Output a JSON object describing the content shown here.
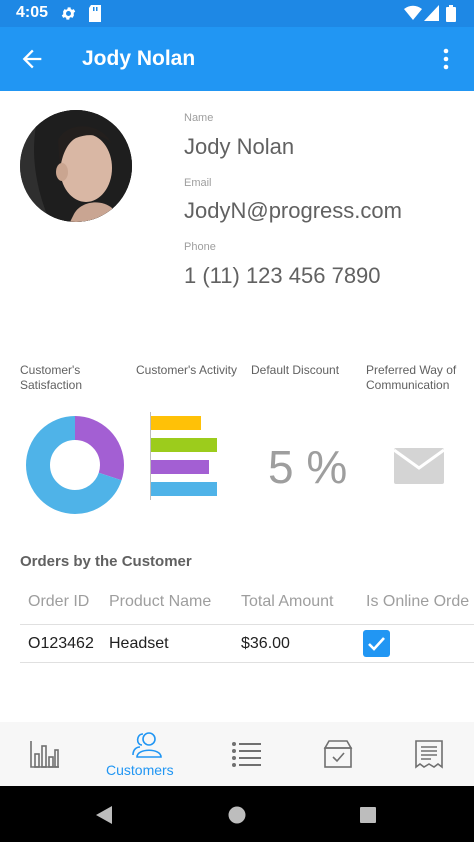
{
  "status_bar": {
    "time": "4:05",
    "icons": [
      "gear-icon",
      "sd-card-icon",
      "wifi-icon",
      "signal-icon",
      "battery-icon"
    ]
  },
  "app_bar": {
    "title": "Jody Nolan",
    "back_icon": "arrow-back-icon",
    "menu_icon": "more-vert-icon"
  },
  "profile": {
    "name_label": "Name",
    "name": "Jody Nolan",
    "email_label": "Email",
    "email": "JodyN@progress.com",
    "phone_label": "Phone",
    "phone": "1 (11) 123 456 7890"
  },
  "kpis": {
    "satisfaction_label_1": "Customer's",
    "satisfaction_label_2": "Satisfaction",
    "activity_label": "Customer's Activity",
    "discount_label": "Default Discount",
    "discount_value": "5 %",
    "communication_label_1": "Preferred Way of",
    "communication_label_2": "Communication",
    "communication_icon": "envelope-icon"
  },
  "satisfaction_chart": {
    "type": "pie",
    "slices": [
      {
        "value": 30,
        "color": "#a35fd3"
      },
      {
        "value": 70,
        "color": "#4fb3e8"
      }
    ]
  },
  "activity_chart": {
    "type": "bar",
    "values": [
      50,
      66,
      58,
      66
    ],
    "colors": [
      "#ffc107",
      "#9ccc1c",
      "#a35fd3",
      "#4fb3e8"
    ]
  },
  "orders": {
    "title": "Orders by the Customer",
    "columns": [
      "Order ID",
      "Product Name",
      "Total Amount",
      "Is Online Orde"
    ],
    "rows": [
      {
        "order_id": "O123462",
        "product": "Headset",
        "amount": "$36.00",
        "is_online": true
      }
    ]
  },
  "bottom_nav": {
    "items": [
      {
        "icon": "bar-chart-icon",
        "label": ""
      },
      {
        "icon": "customers-icon",
        "label": "Customers",
        "selected": true
      },
      {
        "icon": "list-icon",
        "label": ""
      },
      {
        "icon": "box-check-icon",
        "label": ""
      },
      {
        "icon": "receipt-icon",
        "label": ""
      }
    ]
  },
  "system_nav": {
    "icons": [
      "back-triangle-icon",
      "home-circle-icon",
      "recents-square-icon"
    ]
  },
  "colors": {
    "primary": "#2196f3",
    "status_bar": "#1e88e5",
    "label_gray": "#9e9e9e",
    "text_gray": "#616161"
  }
}
